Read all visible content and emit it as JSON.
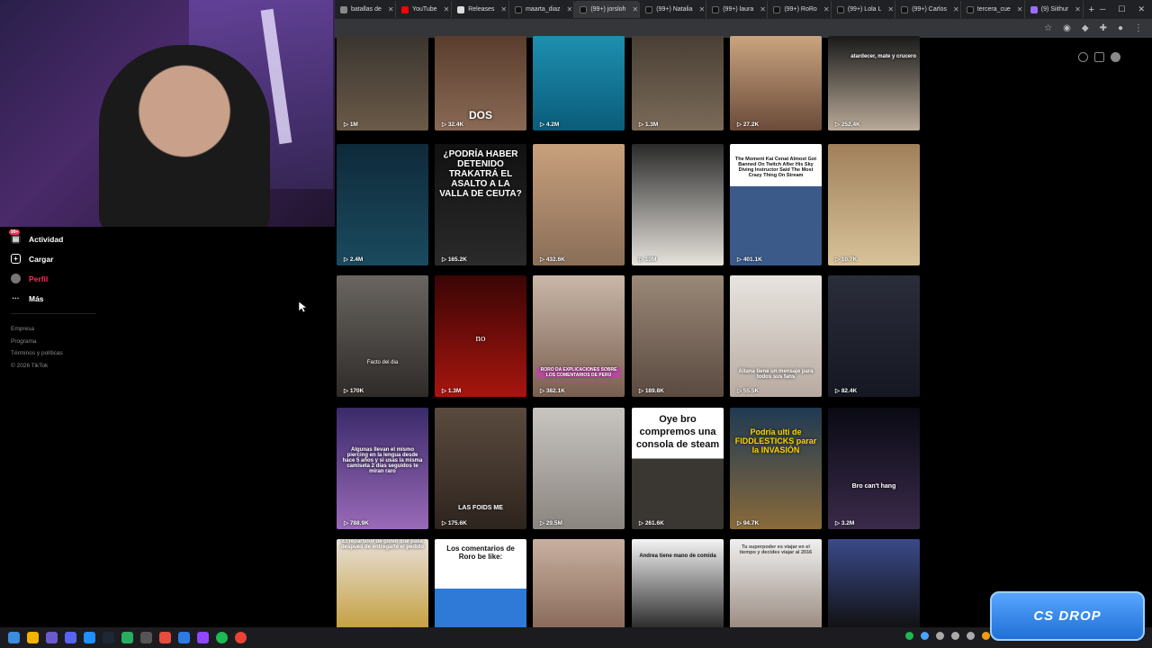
{
  "browser": {
    "tabs": [
      {
        "label": "batallas de",
        "active": false
      },
      {
        "label": "YouTube",
        "active": false
      },
      {
        "label": "Releases",
        "active": false
      },
      {
        "label": "maarta_diaz",
        "active": false
      },
      {
        "label": "(99+) jorsloh",
        "active": true
      },
      {
        "label": "(99+) Natalia",
        "active": false
      },
      {
        "label": "(99+) laura",
        "active": false
      },
      {
        "label": "(99+) RoRo",
        "active": false
      },
      {
        "label": "(99+) Lola L",
        "active": false
      },
      {
        "label": "(99+) Carlos",
        "active": false
      },
      {
        "label": "tercera_cue",
        "active": false
      },
      {
        "label": "(9) Siithur",
        "active": false
      }
    ]
  },
  "sidebar": {
    "items": [
      {
        "label": "Actividad",
        "icon": "inbox-icon",
        "badge": "99+"
      },
      {
        "label": "Cargar",
        "icon": "upload-icon"
      },
      {
        "label": "Perfil",
        "icon": "avatar-icon"
      },
      {
        "label": "Más",
        "icon": "more-icon"
      }
    ],
    "footer": [
      "Empresa",
      "Programa",
      "Términos y políticas",
      "© 2026 TikTok"
    ]
  },
  "videos": [
    {
      "views": "1M",
      "caption": ""
    },
    {
      "views": "32.4K",
      "caption": "DOS"
    },
    {
      "views": "4.2M",
      "caption": ""
    },
    {
      "views": "1.3M",
      "caption": ""
    },
    {
      "views": "27.2K",
      "caption": ""
    },
    {
      "views": "252.4K",
      "caption": "atardecer, mate y crucero"
    },
    {
      "views": "2.4M",
      "caption": ""
    },
    {
      "views": "165.2K",
      "caption": "¿PODRÍA HABER DETENIDO TRAKATRÁ EL ASALTO A LA VALLA DE CEUTA?"
    },
    {
      "views": "432.6K",
      "caption": ""
    },
    {
      "views": "10M",
      "caption": ""
    },
    {
      "views": "401.1K",
      "caption": "The Moment Kai Cenat Almost Got Banned On Twitch After His Sky Diving Instructor Said The Most Crazy Thing On Stream"
    },
    {
      "views": "10.7K",
      "caption": ""
    },
    {
      "views": "170K",
      "caption": "Facto del dia"
    },
    {
      "views": "1.3M",
      "caption": "no"
    },
    {
      "views": "382.1K",
      "caption": "RORO DA EXPLICACIONES SOBRE LOS COMENTARIOS DE PERÚ"
    },
    {
      "views": "189.8K",
      "caption": ""
    },
    {
      "views": "55.5K",
      "caption": "Aitana tiene un mensaje para todos sus fans"
    },
    {
      "views": "82.4K",
      "caption": ""
    },
    {
      "views": "788.9K",
      "caption": "Algunas llevan el mismo piercing en la lengua desde hace 5 años y si usas la misma camiseta 2 días seguidos te miran raro"
    },
    {
      "views": "175.6K",
      "caption": "LAS FOIDS ME"
    },
    {
      "views": "29.5M",
      "caption": ""
    },
    {
      "views": "261.6K",
      "caption": "Oye bro compremos una consola de steam"
    },
    {
      "views": "94.7K",
      "caption": "Podría ulti de FIDDLESTICKS parar la INVASIÓN"
    },
    {
      "views": "3.2M",
      "caption": "Bro can't hang"
    },
    {
      "views": "",
      "caption": "El repartidor de glovo que pasa después de entregarte el pedido"
    },
    {
      "views": "",
      "caption": "Los comentarios de Roro be like:"
    },
    {
      "views": "",
      "caption": ""
    },
    {
      "views": "",
      "caption": "Andrea tiene mano de comida"
    },
    {
      "views": "",
      "caption": "Tu superpoder es viajar en el tiempo y decides viajar al 2016"
    },
    {
      "views": "",
      "caption": ""
    }
  ],
  "promo": {
    "label": "CS DROP"
  },
  "colors": {
    "accent": "#fe2c55",
    "bg": "#000000"
  }
}
